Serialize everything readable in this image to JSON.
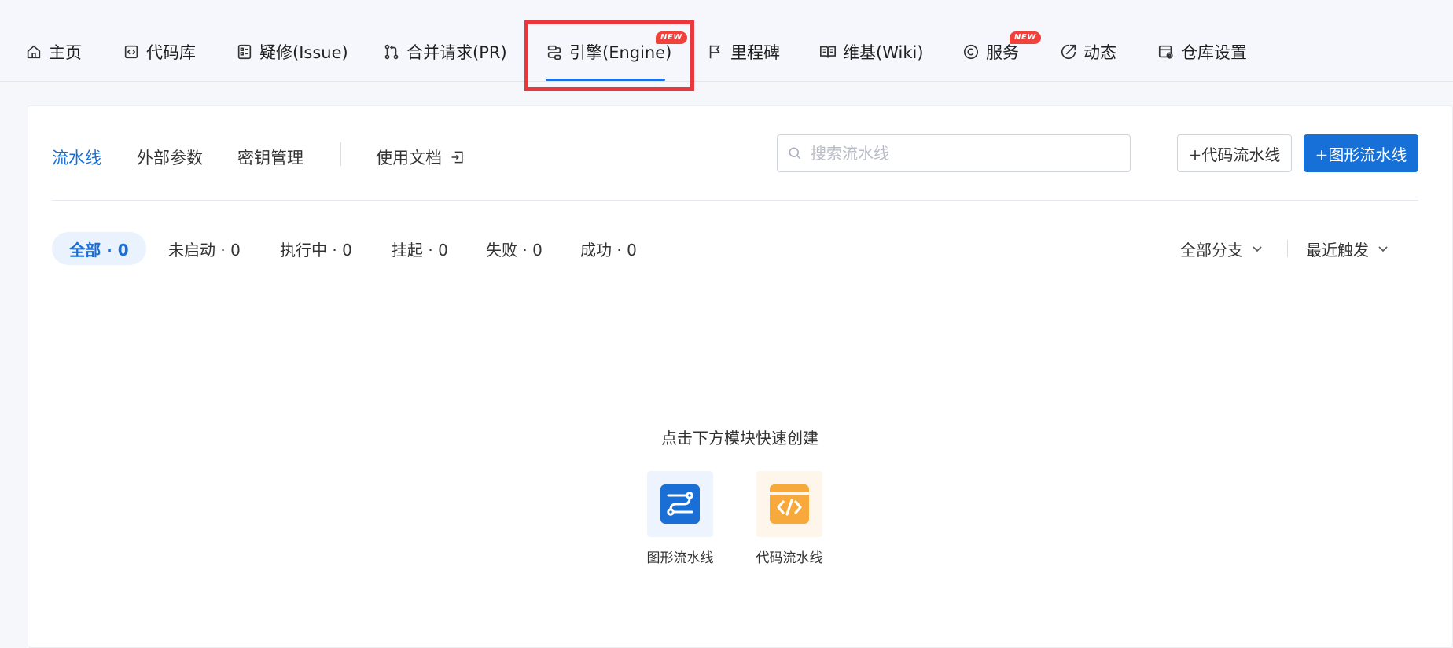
{
  "nav": {
    "items": [
      {
        "label": "主页",
        "icon": "home-icon"
      },
      {
        "label": "代码库",
        "icon": "code-icon"
      },
      {
        "label": "疑修(Issue)",
        "icon": "issue-icon"
      },
      {
        "label": "合并请求(PR)",
        "icon": "pull-request-icon"
      },
      {
        "label": "引擎(Engine)",
        "icon": "engine-icon",
        "badge": "NEW",
        "active": true
      },
      {
        "label": "里程碑",
        "icon": "flag-icon"
      },
      {
        "label": "维基(Wiki)",
        "icon": "book-icon"
      },
      {
        "label": "服务",
        "icon": "service-icon",
        "badge": "NEW"
      },
      {
        "label": "动态",
        "icon": "activity-icon"
      },
      {
        "label": "仓库设置",
        "icon": "settings-icon"
      }
    ]
  },
  "subtabs": {
    "pipeline": "流水线",
    "external_params": "外部参数",
    "secrets": "密钥管理",
    "docs": "使用文档"
  },
  "search": {
    "placeholder": "搜索流水线",
    "value": ""
  },
  "buttons": {
    "code_pipeline": "+代码流水线",
    "graphic_pipeline": "+图形流水线"
  },
  "filters": {
    "all": "全部 · 0",
    "not_started": "未启动 · 0",
    "running": "执行中 · 0",
    "suspended": "挂起 · 0",
    "failed": "失败 · 0",
    "succeeded": "成功 · 0"
  },
  "dropdowns": {
    "branch": "全部分支",
    "sort": "最近触发"
  },
  "empty_state": {
    "title": "点击下方模块快速创建",
    "graphic_label": "图形流水线",
    "code_label": "代码流水线"
  },
  "colors": {
    "accent": "#1670d8",
    "badge": "#f0413b",
    "highlight": "#e8383d",
    "tile_orange": "#f7a93b"
  }
}
